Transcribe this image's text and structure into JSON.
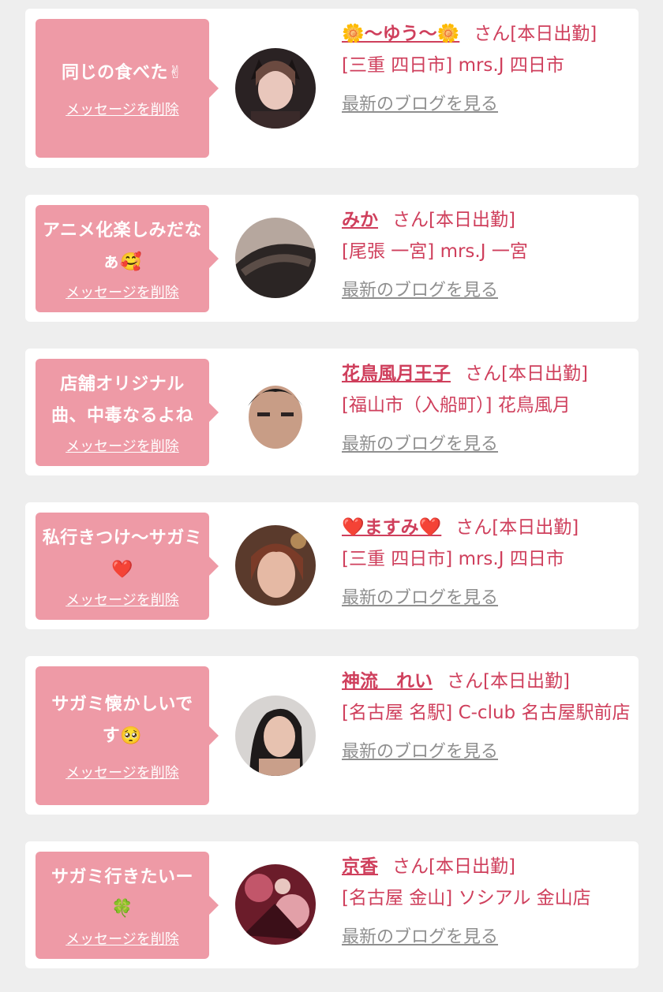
{
  "items": [
    {
      "message": "同じの食べた",
      "message_emoji": "✌",
      "delete_label": "メッセージを削除",
      "name": "🌼〜ゆう〜🌼",
      "suffix": "さん[本日出勤]",
      "shop": "[三重 四日市] mrs.J 四日市",
      "blog_label": "最新のブログを見る"
    },
    {
      "message": "アニメ化楽しみだなぁ",
      "message_emoji": "🥰",
      "delete_label": "メッセージを削除",
      "name": "みか",
      "suffix": "さん[本日出勤]",
      "shop": "[尾張 一宮] mrs.J 一宮",
      "blog_label": "最新のブログを見る"
    },
    {
      "message": "店舗オリジナル曲、中毒なるよね",
      "message_emoji": "",
      "delete_label": "メッセージを削除",
      "name": "花鳥風月王子",
      "suffix": "さん[本日出勤]",
      "shop": "[福山市（入船町）] 花鳥風月",
      "blog_label": "最新のブログを見る"
    },
    {
      "message": "私行きつけ〜サガミ",
      "message_emoji": "❤️",
      "delete_label": "メッセージを削除",
      "name": "❤️ますみ❤️",
      "suffix": "さん[本日出勤]",
      "shop": "[三重 四日市] mrs.J 四日市",
      "blog_label": "最新のブログを見る"
    },
    {
      "message": "サガミ懐かしいです",
      "message_emoji": "🥺",
      "delete_label": "メッセージを削除",
      "name": "神流　れい",
      "suffix": "さん[本日出勤]",
      "shop": "[名古屋 名駅] C-club 名古屋駅前店",
      "blog_label": "最新のブログを見る"
    },
    {
      "message": "サガミ行きたいー",
      "message_emoji": "🍀",
      "delete_label": "メッセージを削除",
      "name": "京香",
      "suffix": "さん[本日出勤]",
      "shop": "[名古屋 金山] ソシアル 金山店",
      "blog_label": "最新のブログを見る"
    }
  ],
  "colors": {
    "bubble": "#ee9aa6",
    "accent": "#cf3f5c",
    "link_gray": "#8f8f8f",
    "background": "#eeeeee"
  }
}
